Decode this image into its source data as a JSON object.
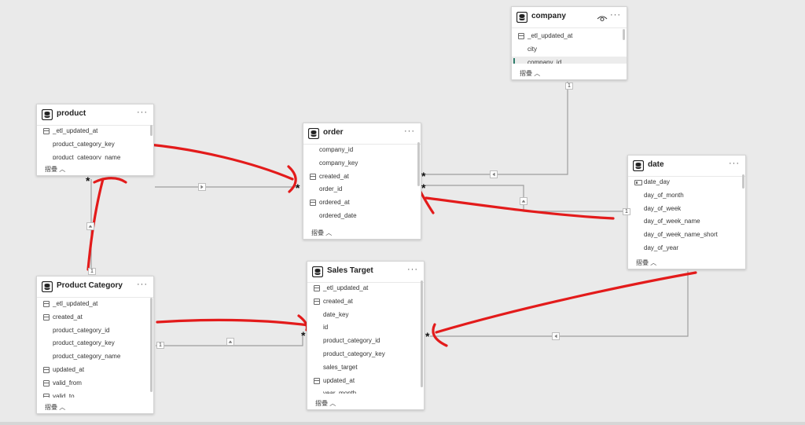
{
  "tables": {
    "company": {
      "title": "company",
      "fields": [
        "_etl_updated_at",
        "city",
        "company_id"
      ],
      "collapse_label": "摺疊"
    },
    "product": {
      "title": "product",
      "fields": [
        "_etl_updated_at",
        "product_category_key",
        "product_category_name"
      ],
      "collapse_label": "摺疊"
    },
    "order": {
      "title": "order",
      "fields": [
        "company_id",
        "company_key",
        "created_at",
        "order_id",
        "ordered_at",
        "ordered_date"
      ],
      "collapse_label": "摺疊"
    },
    "date": {
      "title": "date",
      "fields": [
        "date_day",
        "day_of_month",
        "day_of_week",
        "day_of_week_name",
        "day_of_week_name_short",
        "day_of_year"
      ],
      "collapse_label": "摺疊"
    },
    "product_category": {
      "title": "Product Category",
      "fields": [
        "_etl_updated_at",
        "created_at",
        "product_category_id",
        "product_category_key",
        "product_category_name",
        "updated_at",
        "valid_from",
        "valid_to"
      ],
      "collapse_label": "摺疊"
    },
    "sales_target": {
      "title": "Sales Target",
      "fields": [
        "_etl_updated_at",
        "created_at",
        "date_key",
        "id",
        "product_category_id",
        "product_category_key",
        "sales_target",
        "updated_at",
        "year_month"
      ],
      "collapse_label": "摺疊"
    }
  },
  "cardinality": {
    "one": "1",
    "many": "*"
  },
  "more_menu_label": "···",
  "colors": {
    "canvas": "#eaeaea",
    "relationship_line": "#9e9e9e",
    "annotation": "#e31b1b",
    "selected_accent": "#2e7d6b"
  }
}
